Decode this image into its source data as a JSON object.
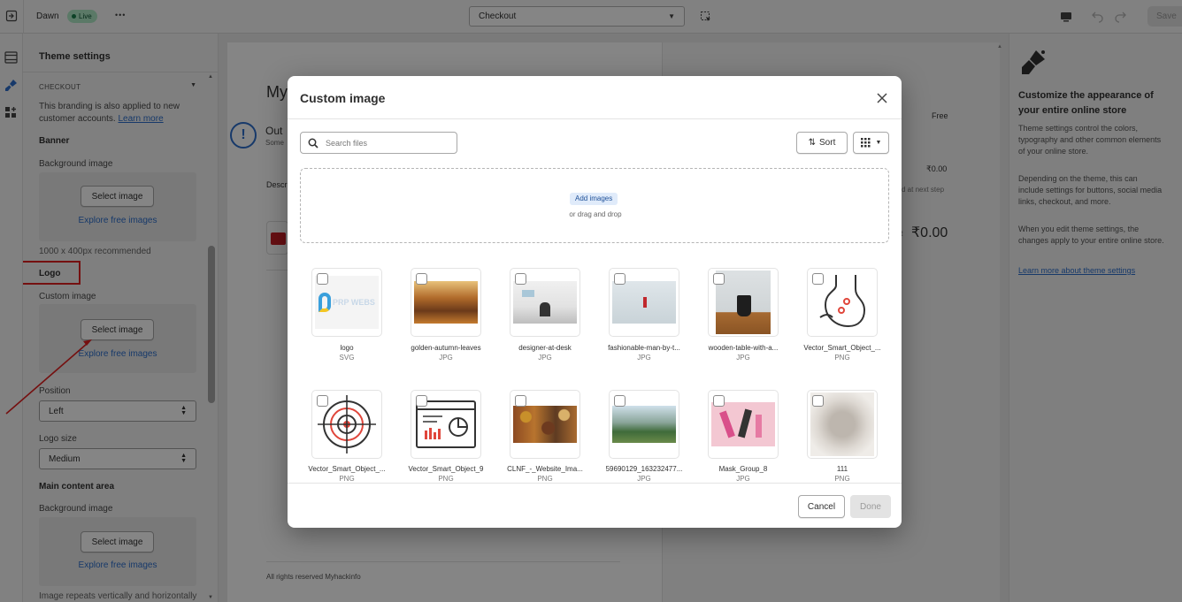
{
  "topbar": {
    "theme_name": "Dawn",
    "live_badge": "Live",
    "more_glyph": "•••",
    "page_selector": "Checkout",
    "save_label": "Save"
  },
  "sidebar": {
    "title": "Theme settings",
    "section_label": "CHECKOUT",
    "branding_note": "This branding is also applied to new customer accounts.",
    "learn_more": "Learn more",
    "banner_heading": "Banner",
    "background_image_label": "Background image",
    "select_image": "Select image",
    "explore_free_images": "Explore free images",
    "banner_hint": "1000 x 400px recommended",
    "logo_heading": "Logo",
    "custom_image_label": "Custom image",
    "position_label": "Position",
    "position_value": "Left",
    "logo_size_label": "Logo size",
    "logo_size_value": "Medium",
    "main_content_heading": "Main content area",
    "main_bg_label": "Background image",
    "main_bg_hint": "Image repeats vertically and horizontally"
  },
  "preview": {
    "heading_partial": "My",
    "out_partial": "Out",
    "some_partial": "Some",
    "desc_partial": "Descr",
    "shipping_value": "Free",
    "subtotal_value": "₹0.00",
    "calc_note": "d at next step",
    "total_value": "₹0.00",
    "total_prefix": "R",
    "footer": "All rights reserved Myhackinfo"
  },
  "rightpanel": {
    "title": "Customize the appearance of your entire online store",
    "p1": "Theme settings control the colors, typography and other common elements of your online store.",
    "p2": "Depending on the theme, this can include settings for buttons, social media links, checkout, and more.",
    "p3": "When you edit theme settings, the changes apply to your entire online store.",
    "link": "Learn more about theme settings"
  },
  "modal": {
    "title": "Custom image",
    "search_placeholder": "Search files",
    "sort_label": "Sort",
    "add_images": "Add images",
    "drag_drop": "or drag and drop",
    "cancel": "Cancel",
    "done": "Done",
    "files": [
      {
        "name": "logo",
        "type": "SVG"
      },
      {
        "name": "golden-autumn-leaves",
        "type": "JPG"
      },
      {
        "name": "designer-at-desk",
        "type": "JPG"
      },
      {
        "name": "fashionable-man-by-t...",
        "type": "JPG"
      },
      {
        "name": "wooden-table-with-a...",
        "type": "JPG"
      },
      {
        "name": "Vector_Smart_Object_...",
        "type": "PNG"
      },
      {
        "name": "Vector_Smart_Object_...",
        "type": "PNG"
      },
      {
        "name": "Vector_Smart_Object_9",
        "type": "PNG"
      },
      {
        "name": "CLNF_-_Website_Ima...",
        "type": "PNG"
      },
      {
        "name": "59690129_163232477...",
        "type": "JPG"
      },
      {
        "name": "Mask_Group_8",
        "type": "JPG"
      },
      {
        "name": "111",
        "type": "PNG"
      }
    ],
    "logo_thumb_text": "PRP WEBS"
  },
  "colors": {
    "accent_link": "#2c6ecb",
    "live_badge_bg": "#aee9c5",
    "highlight_red": "#e02020"
  }
}
